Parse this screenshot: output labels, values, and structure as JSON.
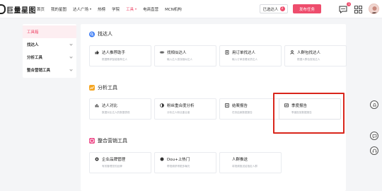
{
  "brand": {
    "logo_text": "巨量星图",
    "accent": "#ee4d6d"
  },
  "nav": [
    {
      "label": "首页",
      "active": false,
      "caret": false
    },
    {
      "label": "我的星图",
      "active": false,
      "caret": false
    },
    {
      "label": "达人广场",
      "active": false,
      "caret": true
    },
    {
      "label": "热榜",
      "active": false,
      "caret": false
    },
    {
      "label": "学院",
      "active": false,
      "caret": false
    },
    {
      "label": "工具",
      "active": true,
      "caret": true
    },
    {
      "label": "电商直营",
      "active": false,
      "caret": false
    },
    {
      "label": "MCN机构",
      "active": false,
      "caret": false
    }
  ],
  "header": {
    "selected_label": "已选达人",
    "selected_count": "2",
    "publish_label": "发布任务",
    "message_count": "1"
  },
  "sidebar": {
    "items": [
      {
        "label": "工具箱",
        "active": true
      },
      {
        "label": "找达人",
        "active": false
      },
      {
        "label": "分析工具",
        "active": false
      },
      {
        "label": "整合营销工具",
        "active": false
      }
    ]
  },
  "sections": [
    {
      "title": "找达人",
      "icon": "search-icon",
      "cards": [
        {
          "title": "达人推荐助手",
          "desc": "根据需求智能推荐达人",
          "icon": "thumb-icon"
        },
        {
          "title": "找相似达人",
          "desc": "输入达人查找相似达人",
          "icon": "link-icon"
        },
        {
          "title": "用订单找达人",
          "desc": "输入订单查看优质达人",
          "icon": "order-icon"
        },
        {
          "title": "人群包找达人",
          "desc": "根据人群包查找达人",
          "icon": "person-icon"
        }
      ]
    },
    {
      "title": "分析工具",
      "icon": "chart-icon",
      "cards": [
        {
          "title": "达人对比",
          "desc": "数据对比达人的数据表现",
          "icon": "compare-icon"
        },
        {
          "title": "粉丝重合度分析",
          "desc": "分析达人粉丝重合度",
          "icon": "overlap-icon"
        },
        {
          "title": "结案报告",
          "desc": "任务结案数据报告",
          "icon": "report-icon"
        },
        {
          "title": "季度报告",
          "desc": "季度投放数据报告",
          "icon": "quarter-icon"
        }
      ]
    },
    {
      "title": "整合营销工具",
      "icon": "cube-icon",
      "cards": [
        {
          "title": "企业品牌管理",
          "desc": "有效管理您的品牌",
          "icon": "brand-icon"
        },
        {
          "title": "Dou+上热门",
          "desc": "帮视频获得更多曝光",
          "icon": "dou-icon"
        },
        {
          "title": "人群推送",
          "desc": "将视频推送给指定人群",
          "icon": "push-icon"
        }
      ]
    }
  ]
}
